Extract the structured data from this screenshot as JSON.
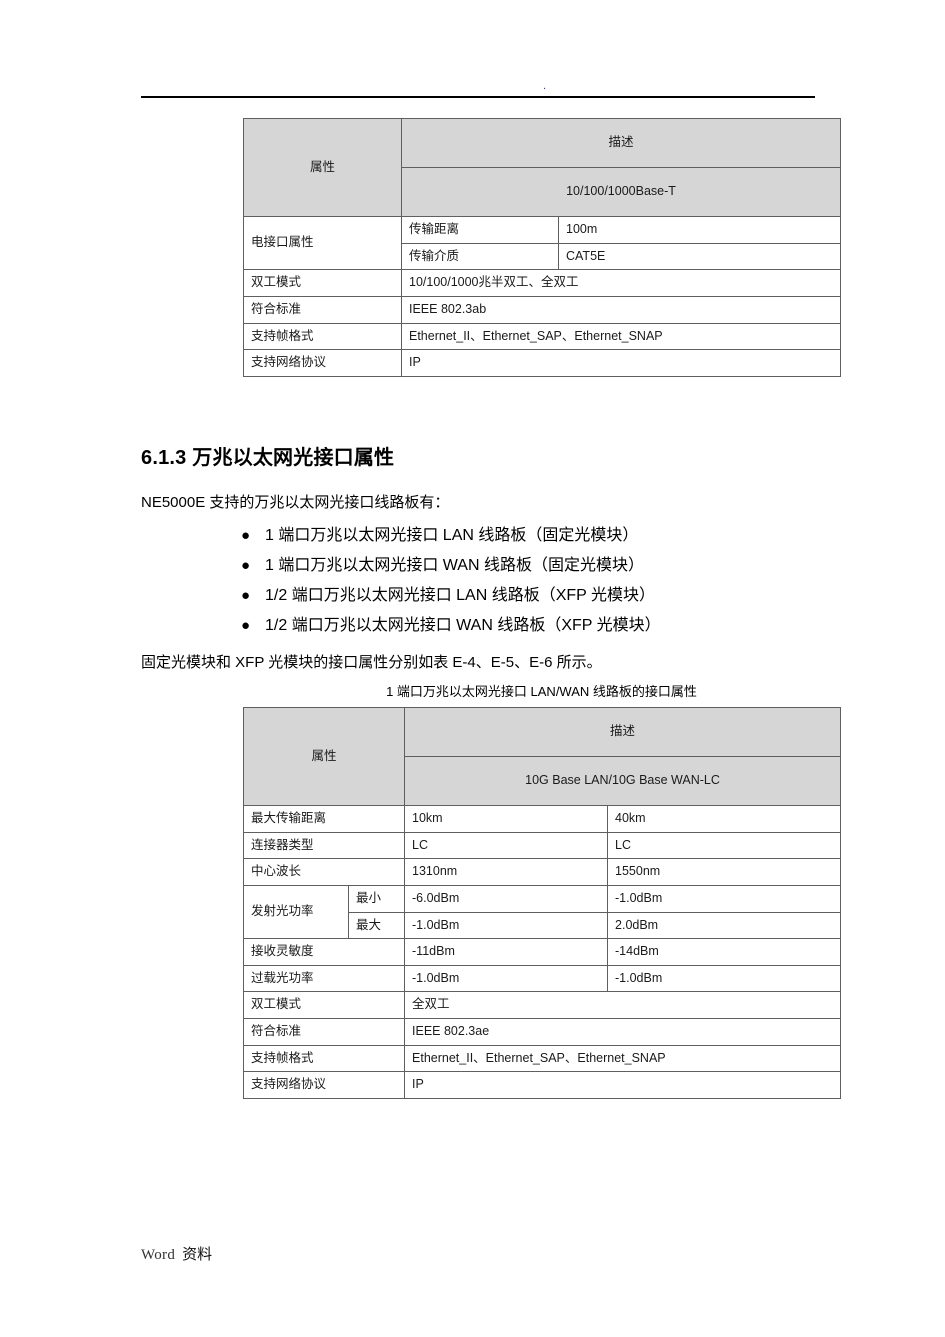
{
  "header": {
    "dot": "."
  },
  "footer": {
    "word_label": "Word",
    "cn_label": "资料"
  },
  "table_electrical": {
    "col_attr_header": "属性",
    "col_desc_header": "描述",
    "col_desc_subheader": "10/100/1000Base-T",
    "rows": [
      {
        "label": "电接口属性",
        "sub": "传输距离",
        "value": "100m"
      },
      {
        "label": "",
        "sub": "传输介质",
        "value": "CAT5E"
      },
      {
        "label": "双工模式",
        "value": "10/100/1000兆半双工、全双工"
      },
      {
        "label": "符合标准",
        "value": "IEEE 802.3ab"
      },
      {
        "label": "支持帧格式",
        "value": "Ethernet_II、Ethernet_SAP、Ethernet_SNAP"
      },
      {
        "label": "支持网络协议",
        "value": "IP"
      }
    ]
  },
  "section": {
    "heading": "6.1.3 万兆以太网光接口属性",
    "intro": "NE5000E 支持的万兆以太网光接口线路板有：",
    "bullet_glyph": "●",
    "bullets": [
      "1 端口万兆以太网光接口 LAN 线路板（固定光模块）",
      "1 端口万兆以太网光接口 WAN 线路板（固定光模块）",
      "1/2 端口万兆以太网光接口 LAN 线路板（XFP 光模块）",
      "1/2 端口万兆以太网光接口 WAN 线路板（XFP 光模块）"
    ],
    "outro": "固定光模块和 XFP 光模块的接口属性分别如表 E-4、E-5、E-6 所示。"
  },
  "table_optical": {
    "caption": "1 端口万兆以太网光接口 LAN/WAN 线路板的接口属性",
    "col_attr_header": "属性",
    "col_desc_header": "描述",
    "col_desc_subheader": "10G Base LAN/10G Base WAN-LC",
    "rows": [
      {
        "label": "最大传输距离",
        "value1": "10km",
        "value2": "40km"
      },
      {
        "label": "连接器类型",
        "value1": "LC",
        "value2": "LC"
      },
      {
        "label": "中心波长",
        "value1": "1310nm",
        "value2": "1550nm"
      },
      {
        "label": "发射光功率",
        "sub": "最小",
        "value1": "-6.0dBm",
        "value2": "-1.0dBm"
      },
      {
        "label": "",
        "sub": "最大",
        "value1": "-1.0dBm",
        "value2": "2.0dBm"
      },
      {
        "label": "接收灵敏度",
        "value1": "-11dBm",
        "value2": "-14dBm"
      },
      {
        "label": "过载光功率",
        "value1": "-1.0dBm",
        "value2": "-1.0dBm"
      },
      {
        "label": "双工模式",
        "value_span": "全双工"
      },
      {
        "label": "符合标准",
        "value_span": "IEEE 802.3ae"
      },
      {
        "label": "支持帧格式",
        "value_span": "Ethernet_II、Ethernet_SAP、Ethernet_SNAP"
      },
      {
        "label": "支持网络协议",
        "value_span": "IP"
      }
    ]
  },
  "colors": {
    "table_header_fill": "#d6d6d6",
    "table_border": "#5f5f5f",
    "rule": "#000000"
  }
}
